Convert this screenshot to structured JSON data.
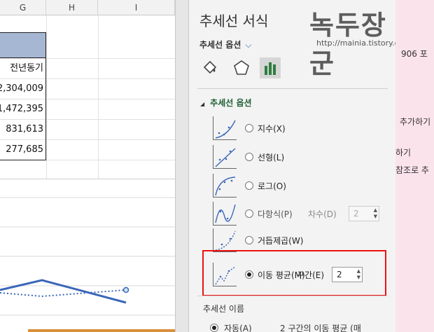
{
  "sheet": {
    "columns": [
      "G",
      "H",
      "I"
    ],
    "header_cell": "전년동기",
    "values": [
      "2,304,009",
      "1,472,395",
      "831,613",
      "277,685"
    ]
  },
  "pane": {
    "title": "추세선 서식",
    "dropdown_label": "추세선 옵션",
    "section_label": "추세선 옵션",
    "options": {
      "exponential": "지수(X)",
      "linear": "선형(L)",
      "log": "로그(O)",
      "polynomial": "다항식(P)",
      "power": "거듭제곱(W)",
      "moving_avg": "이동 평균(M)"
    },
    "order_label": "차수(D)",
    "order_value": "2",
    "period_label": "구간(E)",
    "period_value": "2",
    "trendline_name_label": "추세선 이름",
    "auto_label": "자동(A)",
    "auto_name": "2 구간의 이동 평균 (매"
  },
  "watermark": {
    "text": "녹두장군",
    "url": "http://mainia.tistory.com"
  },
  "side_text": [
    "906 포",
    "추가하기",
    "하기",
    "참조로 추"
  ]
}
